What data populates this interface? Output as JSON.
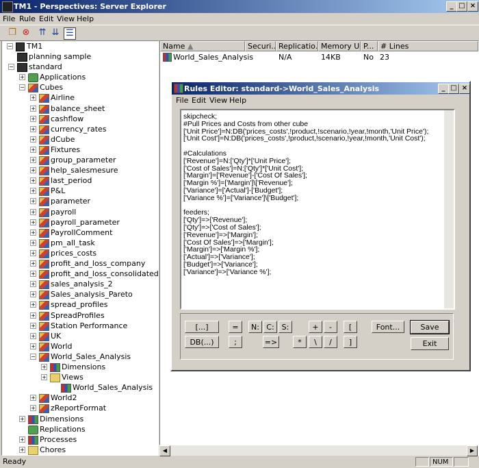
{
  "window": {
    "title": "TM1 - Perspectives: Server Explorer"
  },
  "menu": [
    "File",
    "Rule",
    "Edit",
    "View",
    "Help"
  ],
  "tree": {
    "root": "TM1",
    "nodes": [
      {
        "label": "planning sample",
        "depth": 1,
        "icon": "server-icon",
        "pm": ""
      },
      {
        "label": "standard",
        "depth": 1,
        "icon": "server-icon",
        "pm": "−"
      },
      {
        "label": "Applications",
        "depth": 2,
        "icon": "applications-icon",
        "pm": "+"
      },
      {
        "label": "Cubes",
        "depth": 2,
        "icon": "cubes-icon",
        "pm": "−"
      },
      {
        "label": "Airline",
        "depth": 3,
        "icon": "cube-icon",
        "pm": "+"
      },
      {
        "label": "balance_sheet",
        "depth": 3,
        "icon": "cube-icon",
        "pm": "+"
      },
      {
        "label": "cashflow",
        "depth": 3,
        "icon": "cube-icon",
        "pm": "+"
      },
      {
        "label": "currency_rates",
        "depth": 3,
        "icon": "cube-icon",
        "pm": "+"
      },
      {
        "label": "dCube",
        "depth": 3,
        "icon": "cube-icon",
        "pm": "+"
      },
      {
        "label": "Fixtures",
        "depth": 3,
        "icon": "cube-icon",
        "pm": "+"
      },
      {
        "label": "group_parameter",
        "depth": 3,
        "icon": "cube-icon",
        "pm": "+"
      },
      {
        "label": "help_salesmesure",
        "depth": 3,
        "icon": "cube-icon",
        "pm": "+"
      },
      {
        "label": "last_period",
        "depth": 3,
        "icon": "cube-icon",
        "pm": "+"
      },
      {
        "label": "P&L",
        "depth": 3,
        "icon": "cube-icon",
        "pm": "+"
      },
      {
        "label": "parameter",
        "depth": 3,
        "icon": "cube-icon",
        "pm": "+"
      },
      {
        "label": "payroll",
        "depth": 3,
        "icon": "cube-icon",
        "pm": "+"
      },
      {
        "label": "payroll_parameter",
        "depth": 3,
        "icon": "cube-icon",
        "pm": "+"
      },
      {
        "label": "PayrollComment",
        "depth": 3,
        "icon": "cube-icon",
        "pm": "+"
      },
      {
        "label": "pm_all_task",
        "depth": 3,
        "icon": "cube-icon",
        "pm": "+"
      },
      {
        "label": "prices_costs",
        "depth": 3,
        "icon": "cube-icon",
        "pm": "+"
      },
      {
        "label": "profit_and_loss_company",
        "depth": 3,
        "icon": "cube-icon",
        "pm": "+"
      },
      {
        "label": "profit_and_loss_consolidated",
        "depth": 3,
        "icon": "cube-icon",
        "pm": "+"
      },
      {
        "label": "sales_analysis_2",
        "depth": 3,
        "icon": "cube-icon",
        "pm": "+"
      },
      {
        "label": "Sales_analysis_Pareto",
        "depth": 3,
        "icon": "cube-icon",
        "pm": "+"
      },
      {
        "label": "spread_profiles",
        "depth": 3,
        "icon": "cube-icon",
        "pm": "+"
      },
      {
        "label": "SpreadProfiles",
        "depth": 3,
        "icon": "cube-icon",
        "pm": "+"
      },
      {
        "label": "Station Performance",
        "depth": 3,
        "icon": "cube-icon",
        "pm": "+"
      },
      {
        "label": "UK",
        "depth": 3,
        "icon": "cube-icon",
        "pm": "+"
      },
      {
        "label": "World",
        "depth": 3,
        "icon": "cube-icon",
        "pm": "+"
      },
      {
        "label": "World_Sales_Analysis",
        "depth": 3,
        "icon": "cube-icon",
        "pm": "−"
      },
      {
        "label": "Dimensions",
        "depth": 4,
        "icon": "dimensions-icon",
        "pm": "+"
      },
      {
        "label": "Views",
        "depth": 4,
        "icon": "views-icon",
        "pm": "+"
      },
      {
        "label": "World_Sales_Analysis",
        "depth": 4,
        "icon": "rule-icon",
        "pm": "",
        "indent": 1
      },
      {
        "label": "World2",
        "depth": 3,
        "icon": "cube-icon",
        "pm": "+"
      },
      {
        "label": "zReportFormat",
        "depth": 3,
        "icon": "cube-icon",
        "pm": "+"
      },
      {
        "label": "Dimensions",
        "depth": 2,
        "icon": "dimensions-icon",
        "pm": "+"
      },
      {
        "label": "Replications",
        "depth": 2,
        "icon": "replications-icon",
        "pm": ""
      },
      {
        "label": "Processes",
        "depth": 2,
        "icon": "processes-icon",
        "pm": "+"
      },
      {
        "label": "Chores",
        "depth": 2,
        "icon": "chores-icon",
        "pm": "+"
      }
    ]
  },
  "list": {
    "columns": [
      "Name",
      "Securi...",
      "Replicatio...",
      "Memory Used",
      "P...",
      "# Lines"
    ],
    "rows": [
      {
        "name": "World_Sales_Analysis",
        "security": "",
        "replication": "N/A",
        "memory": "14KB",
        "p": "No",
        "lines": "23"
      }
    ]
  },
  "status": {
    "text": "Ready",
    "num": "NUM"
  },
  "rules_editor": {
    "title": "Rules Editor:  standard->World_Sales_Analysis",
    "menu": [
      "File",
      "Edit",
      "View",
      "Help"
    ],
    "code": "skipcheck;\n#Pull Prices and Costs from other cube\n['Unit Price']=N:DB('prices_costs',!product,!scenario,!year,!month,'Unit Price');\n['Unit Cost']=N:DB('prices_costs',!product,!scenario,!year,!month,'Unit Cost');\n\n#Calculations\n['Revenue']=N:['Qty']*['Unit Price'];\n['Cost of Sales']=N:['Qty']*['Unit Cost'];\n['Margin']=['Revenue']-['Cost Of Sales'];\n['Margin %']=['Margin']\\['Revenue'];\n['Variance']=['Actual']-['Budget'];\n['Variance %']=['Variance']\\['Budget'];\n\nfeeders;\n['Qty']=>['Revenue'];\n['Qty']=>['Cost of Sales'];\n['Revenue']=>['Margin'];\n['Cost Of Sales']=>['Margin'];\n['Margin']=>['Margin %'];\n['Actual']=>['Variance'];\n['Budget']=>['Variance'];\n['Variance']=>['Variance %'];",
    "buttons": {
      "bracket_dots": "[...]",
      "db": "DB(...)",
      "eq": "=",
      "semi": ";",
      "n": "N:",
      "c": "C:",
      "s": "S:",
      "arrow": "=>",
      "plus": "+",
      "minus": "-",
      "star": "*",
      "back": "\\",
      "slash": "/",
      "lbr": "[",
      "rbr": "]",
      "font": "Font...",
      "save": "Save",
      "exit": "Exit"
    }
  }
}
